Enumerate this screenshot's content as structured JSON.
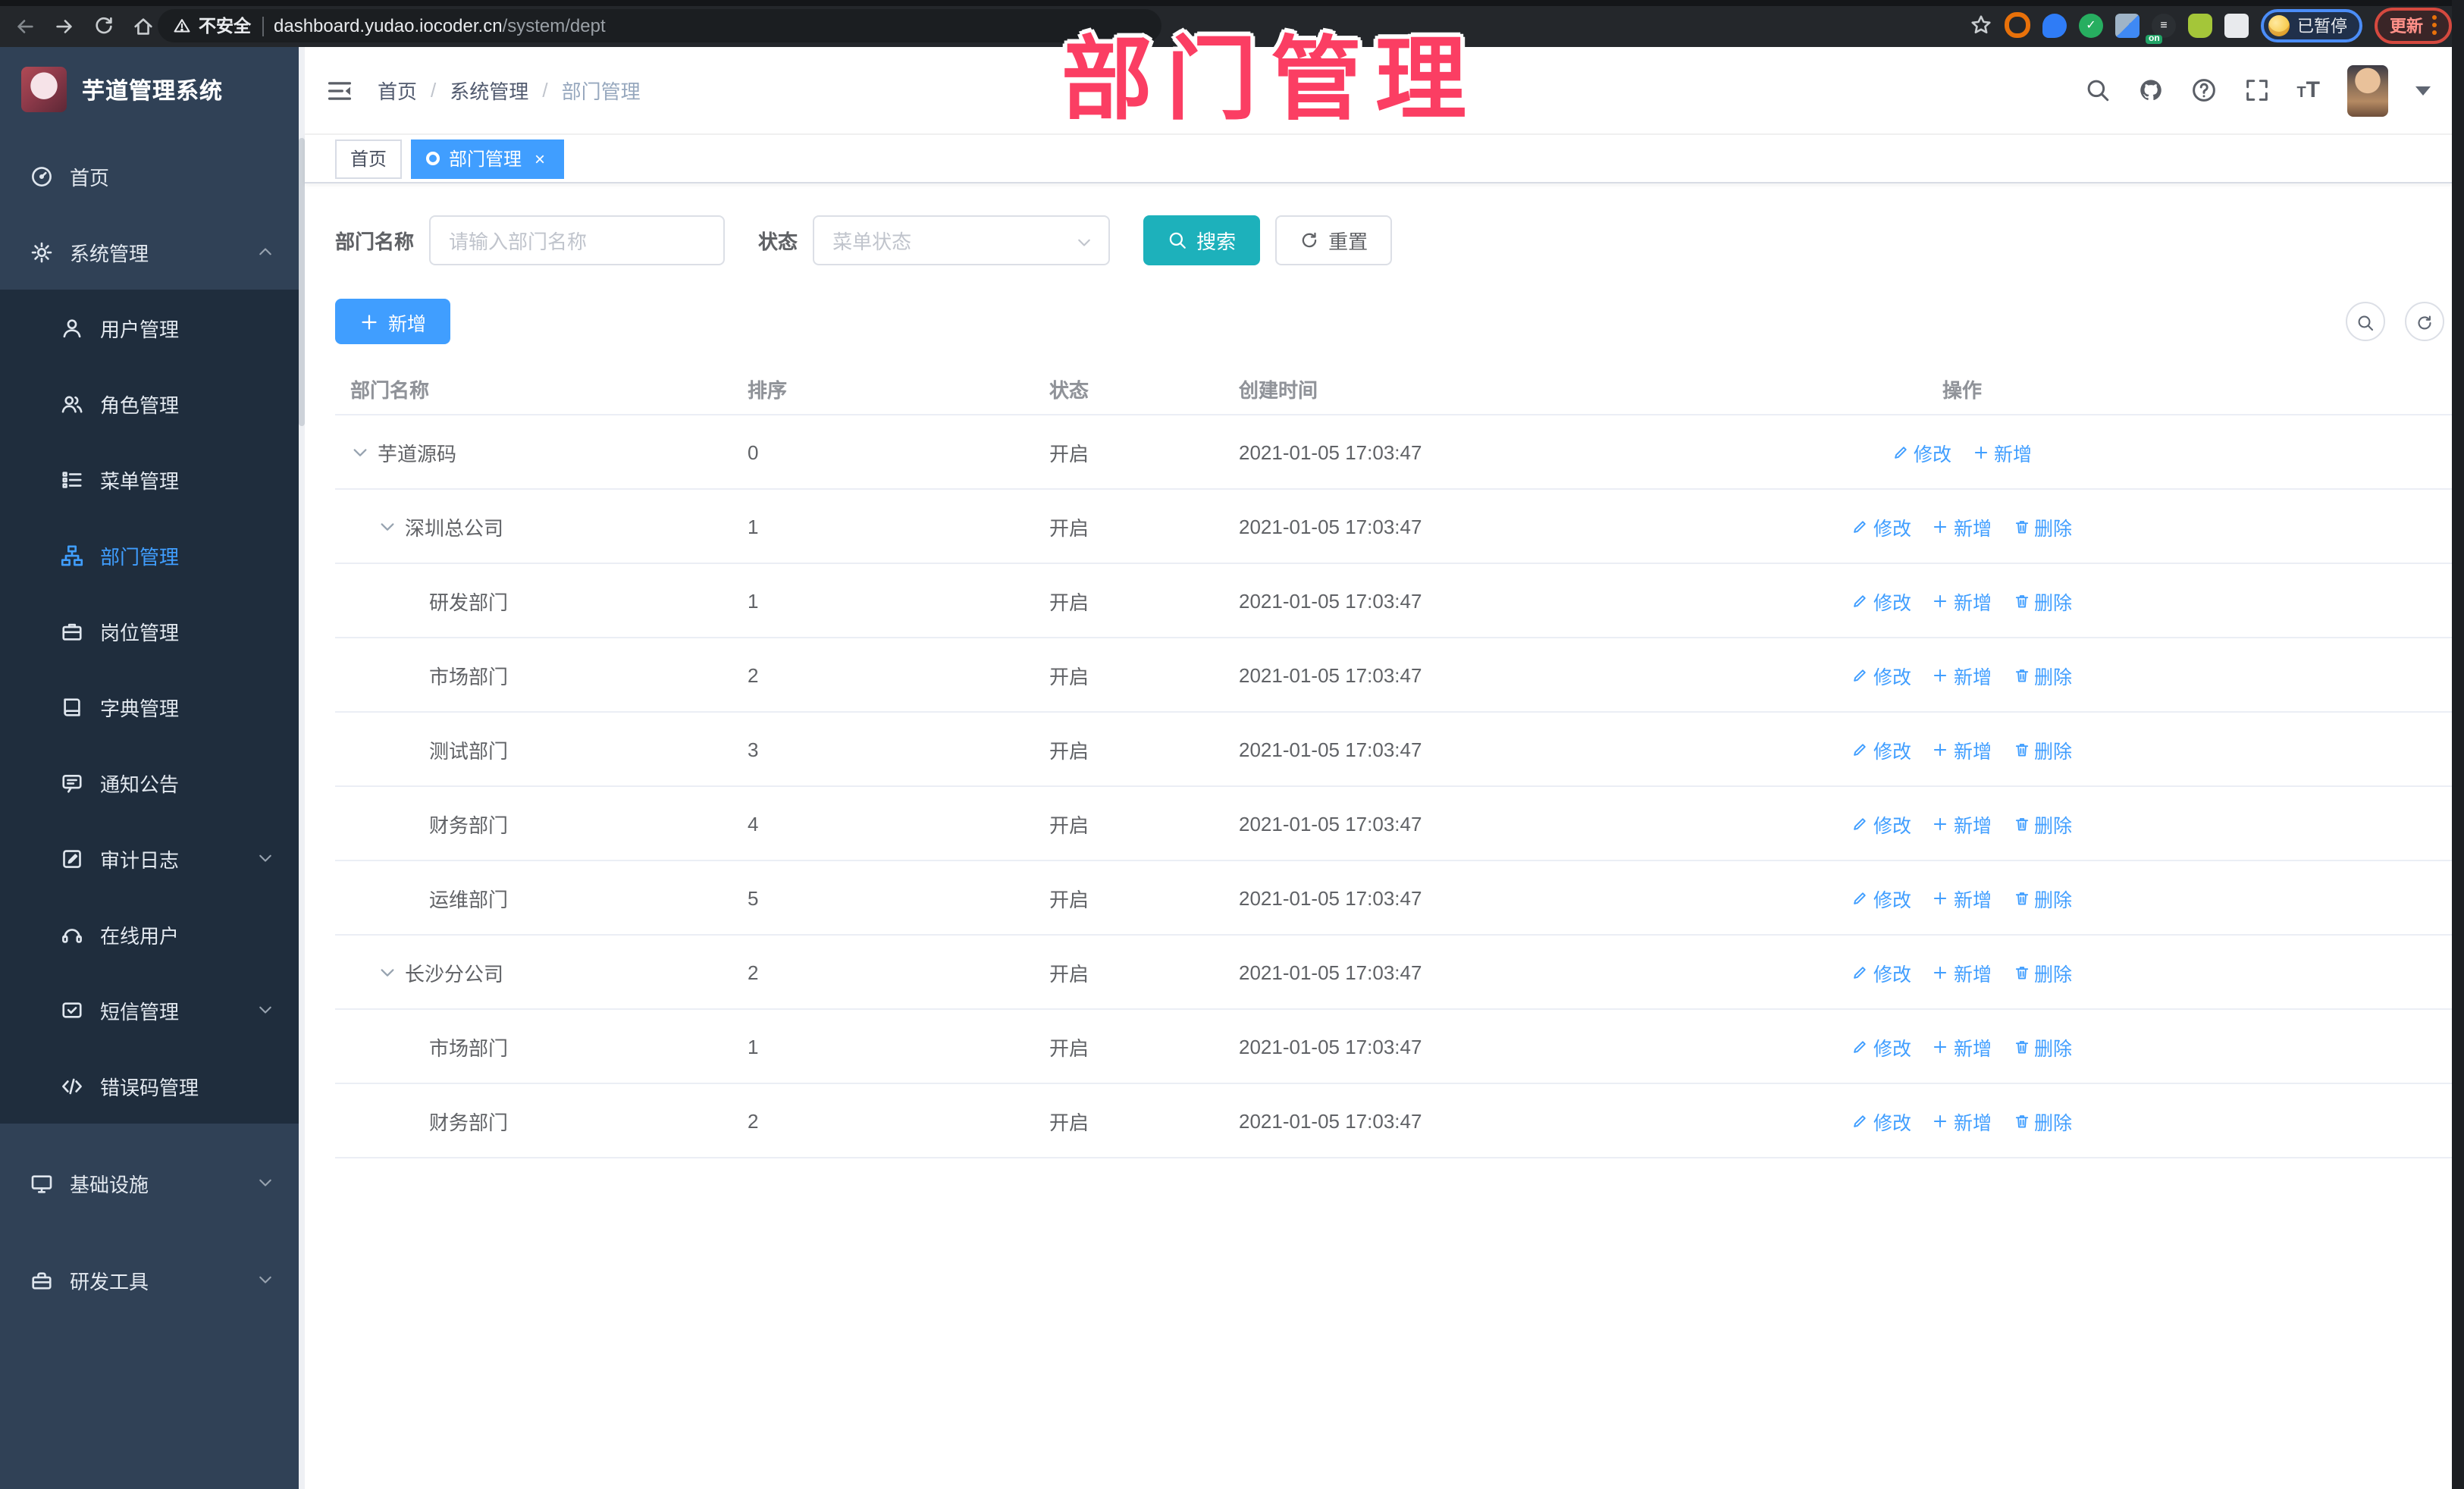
{
  "colors": {
    "accent": "#409eff",
    "search_teal": "#1db1bb",
    "sidebar_bg": "#304156",
    "submenu_bg": "#1f2d3d",
    "annotation_pink": "#fb3e63"
  },
  "annotation": {
    "text": "部门管理"
  },
  "browser": {
    "security_label": "不安全",
    "url_host": "dashboard.yudao.iocoder.cn",
    "url_path": "/system/dept",
    "paused_label": "已暂停",
    "update_label": "更新",
    "nav_icons": [
      "back",
      "forward",
      "reload",
      "home"
    ],
    "extensions": [
      {
        "name": "extension-orange-ring",
        "color": "#e8710a",
        "glyph": ""
      },
      {
        "name": "extension-blue-pin",
        "color": "#2f7cf6",
        "glyph": ""
      },
      {
        "name": "extension-green-check",
        "color": "#27ae60",
        "glyph": "✓"
      },
      {
        "name": "extension-grid",
        "color": "#8f9aa6",
        "glyph": ""
      },
      {
        "name": "extension-list-on",
        "color": "#2b2f33",
        "glyph": "≡",
        "badge": "on"
      },
      {
        "name": "extension-green-bot",
        "color": "#a4c639",
        "glyph": ""
      },
      {
        "name": "extension-puzzle",
        "color": "#e8eaed",
        "glyph": ""
      }
    ]
  },
  "sidebar": {
    "logo_title": "芋道管理系统",
    "items": [
      {
        "label": "首页",
        "icon": "dashboard",
        "type": "top"
      },
      {
        "label": "系统管理",
        "icon": "gear",
        "type": "top",
        "chevron": "up"
      },
      {
        "label": "用户管理",
        "icon": "user",
        "type": "sub"
      },
      {
        "label": "角色管理",
        "icon": "users",
        "type": "sub"
      },
      {
        "label": "菜单管理",
        "icon": "tree",
        "type": "sub"
      },
      {
        "label": "部门管理",
        "icon": "org",
        "type": "sub",
        "active": true
      },
      {
        "label": "岗位管理",
        "icon": "briefcase",
        "type": "sub"
      },
      {
        "label": "字典管理",
        "icon": "book",
        "type": "sub"
      },
      {
        "label": "通知公告",
        "icon": "notice",
        "type": "sub"
      },
      {
        "label": "审计日志",
        "icon": "audit",
        "type": "sub",
        "chevron": "down"
      },
      {
        "label": "在线用户",
        "icon": "online",
        "type": "sub"
      },
      {
        "label": "短信管理",
        "icon": "sms",
        "type": "sub",
        "chevron": "down"
      },
      {
        "label": "错误码管理",
        "icon": "code",
        "type": "sub"
      },
      {
        "label": "基础设施",
        "icon": "monitor",
        "type": "top",
        "chevron": "down",
        "gap": true
      },
      {
        "label": "研发工具",
        "icon": "toolbox",
        "type": "top",
        "chevron": "down",
        "gap": true
      }
    ]
  },
  "header": {
    "breadcrumb": [
      "首页",
      "系统管理",
      "部门管理"
    ],
    "icons": [
      "search",
      "github",
      "help",
      "fullscreen",
      "font-size"
    ]
  },
  "tabs": [
    {
      "label": "首页",
      "active": false
    },
    {
      "label": "部门管理",
      "active": true,
      "closable": true
    }
  ],
  "filter": {
    "dept_label": "部门名称",
    "dept_placeholder": "请输入部门名称",
    "status_label": "状态",
    "status_placeholder": "菜单状态",
    "search_label": "搜索",
    "reset_label": "重置"
  },
  "toolbar": {
    "add_label": "新增"
  },
  "table": {
    "columns": [
      "部门名称",
      "排序",
      "状态",
      "创建时间",
      "操作"
    ],
    "rows": [
      {
        "name": "芋道源码",
        "level": 1,
        "expandable": true,
        "sort": "0",
        "status": "开启",
        "created": "2021-01-05 17:03:47",
        "actions": [
          {
            "icon": "pencil",
            "label": "修改"
          },
          {
            "icon": "plus",
            "label": "新增"
          }
        ]
      },
      {
        "name": "深圳总公司",
        "level": 2,
        "expandable": true,
        "sort": "1",
        "status": "开启",
        "created": "2021-01-05 17:03:47",
        "actions": [
          {
            "icon": "pencil",
            "label": "修改"
          },
          {
            "icon": "plus",
            "label": "新增"
          },
          {
            "icon": "trash",
            "label": "删除"
          }
        ]
      },
      {
        "name": "研发部门",
        "level": 3,
        "expandable": false,
        "sort": "1",
        "status": "开启",
        "created": "2021-01-05 17:03:47",
        "actions": [
          {
            "icon": "pencil",
            "label": "修改"
          },
          {
            "icon": "plus",
            "label": "新增"
          },
          {
            "icon": "trash",
            "label": "删除"
          }
        ]
      },
      {
        "name": "市场部门",
        "level": 3,
        "expandable": false,
        "sort": "2",
        "status": "开启",
        "created": "2021-01-05 17:03:47",
        "actions": [
          {
            "icon": "pencil",
            "label": "修改"
          },
          {
            "icon": "plus",
            "label": "新增"
          },
          {
            "icon": "trash",
            "label": "删除"
          }
        ]
      },
      {
        "name": "测试部门",
        "level": 3,
        "expandable": false,
        "sort": "3",
        "status": "开启",
        "created": "2021-01-05 17:03:47",
        "actions": [
          {
            "icon": "pencil",
            "label": "修改"
          },
          {
            "icon": "plus",
            "label": "新增"
          },
          {
            "icon": "trash",
            "label": "删除"
          }
        ]
      },
      {
        "name": "财务部门",
        "level": 3,
        "expandable": false,
        "sort": "4",
        "status": "开启",
        "created": "2021-01-05 17:03:47",
        "actions": [
          {
            "icon": "pencil",
            "label": "修改"
          },
          {
            "icon": "plus",
            "label": "新增"
          },
          {
            "icon": "trash",
            "label": "删除"
          }
        ]
      },
      {
        "name": "运维部门",
        "level": 3,
        "expandable": false,
        "sort": "5",
        "status": "开启",
        "created": "2021-01-05 17:03:47",
        "actions": [
          {
            "icon": "pencil",
            "label": "修改"
          },
          {
            "icon": "plus",
            "label": "新增"
          },
          {
            "icon": "trash",
            "label": "删除"
          }
        ]
      },
      {
        "name": "长沙分公司",
        "level": 2,
        "expandable": true,
        "sort": "2",
        "status": "开启",
        "created": "2021-01-05 17:03:47",
        "actions": [
          {
            "icon": "pencil",
            "label": "修改"
          },
          {
            "icon": "plus",
            "label": "新增"
          },
          {
            "icon": "trash",
            "label": "删除"
          }
        ]
      },
      {
        "name": "市场部门",
        "level": 3,
        "expandable": false,
        "sort": "1",
        "status": "开启",
        "created": "2021-01-05 17:03:47",
        "actions": [
          {
            "icon": "pencil",
            "label": "修改"
          },
          {
            "icon": "plus",
            "label": "新增"
          },
          {
            "icon": "trash",
            "label": "删除"
          }
        ]
      },
      {
        "name": "财务部门",
        "level": 3,
        "expandable": false,
        "sort": "2",
        "status": "开启",
        "created": "2021-01-05 17:03:47",
        "actions": [
          {
            "icon": "pencil",
            "label": "修改"
          },
          {
            "icon": "plus",
            "label": "新增"
          },
          {
            "icon": "trash",
            "label": "删除"
          }
        ]
      }
    ]
  }
}
